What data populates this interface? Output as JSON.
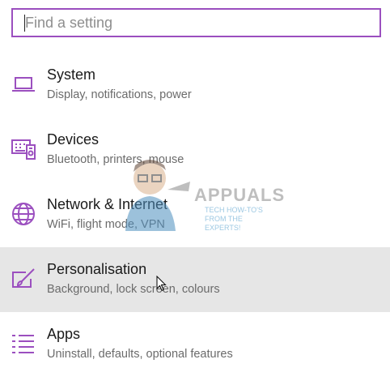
{
  "search": {
    "placeholder": "Find a setting",
    "value": ""
  },
  "settings": [
    {
      "title": "System",
      "description": "Display, notifications, power",
      "icon": "laptop-icon"
    },
    {
      "title": "Devices",
      "description": "Bluetooth, printers, mouse",
      "icon": "devices-icon"
    },
    {
      "title": "Network & Internet",
      "description": "WiFi, flight mode, VPN",
      "icon": "globe-icon"
    },
    {
      "title": "Personalisation",
      "description": "Background, lock screen, colours",
      "icon": "paintbrush-icon",
      "selected": true
    },
    {
      "title": "Apps",
      "description": "Uninstall, defaults, optional features",
      "icon": "list-icon"
    }
  ],
  "watermark": {
    "title": "APPUALS",
    "subtitle": "TECH HOW-TO'S FROM THE EXPERTS!"
  },
  "colors": {
    "accent": "#9b4fbf",
    "selected_background": "#e6e6e6"
  }
}
